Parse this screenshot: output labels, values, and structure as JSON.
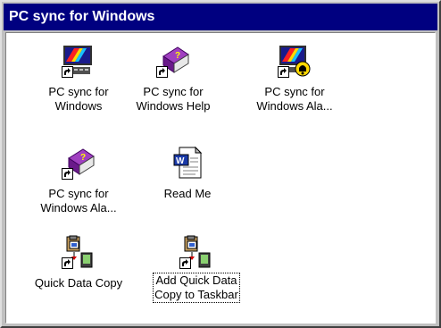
{
  "window": {
    "title": "PC sync for Windows"
  },
  "items": [
    {
      "label": "PC sync for\nWindows",
      "icon": "pc-sync-app-icon"
    },
    {
      "label": "PC sync for\nWindows Help",
      "icon": "help-book-icon"
    },
    {
      "label": "PC sync for\nWindows Ala...",
      "icon": "pc-sync-alarm-icon"
    },
    {
      "label": "PC sync for\nWindows Ala...",
      "icon": "help-book-icon"
    },
    {
      "label": "Read Me",
      "icon": "word-document-icon"
    },
    {
      "label": "Quick Data Copy",
      "icon": "quick-data-copy-icon"
    },
    {
      "label": "Add Quick Data\nCopy to Taskbar",
      "icon": "quick-data-copy-icon"
    }
  ]
}
